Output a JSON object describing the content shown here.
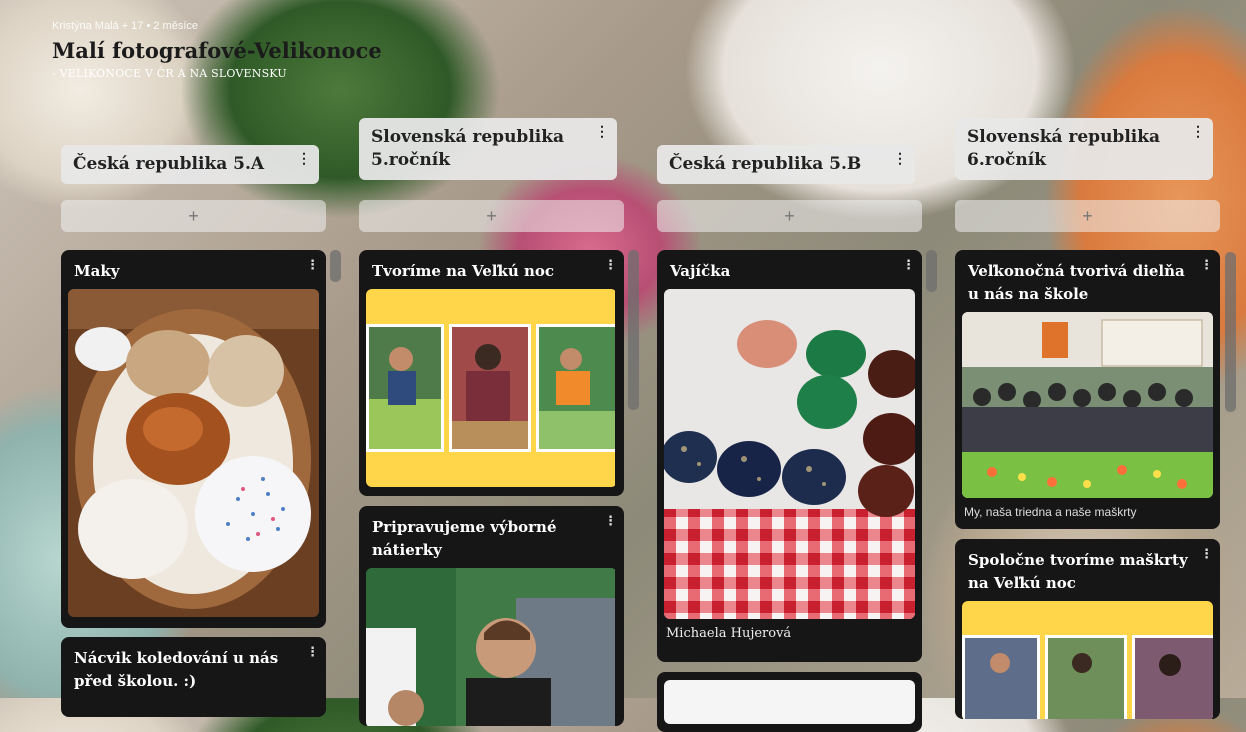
{
  "header": {
    "meta": "Kristýna Malá + 17 • 2 měsíce",
    "title": "Malí fotografové-Velikonoce",
    "subtitle": "- VELIKONOCE V ČR A NA SLOVENSKU"
  },
  "columns": [
    {
      "title": "Česká republika 5.A",
      "add_label": "+",
      "cards": [
        {
          "title": "Maky",
          "image": "photo-easter-breads-basket"
        },
        {
          "title": "Nácvik koledování u nás před školou. :)"
        }
      ]
    },
    {
      "title": "Slovenská republika 5.ročník",
      "add_label": "+",
      "cards": [
        {
          "title": "Tvoríme na Veľkú noc",
          "image": "collage-children-crafting"
        },
        {
          "title": "Pripravujeme výborné nátierky",
          "image": "photo-boy-in-classroom"
        }
      ]
    },
    {
      "title": "Česká republika 5.B",
      "add_label": "+",
      "cards": [
        {
          "title": "Vajíčka",
          "image": "photo-dyed-eggs",
          "caption": "Michaela Hujerová"
        },
        {
          "title": "",
          "image": "photo-white"
        }
      ]
    },
    {
      "title": "Slovenská republika 6.ročník",
      "add_label": "+",
      "cards": [
        {
          "title": "Veľkonočná tvorivá dielňa u nás na škole",
          "image": "photo-class-group",
          "caption": "My, naša triedna a naše maškrty"
        },
        {
          "title": "Spoločne tvoríme maškrty na Veľkú noc",
          "image": "collage-children-food"
        }
      ]
    }
  ],
  "icons": {
    "more": "more-vertical-icon"
  },
  "colors": {
    "card_bg": "#161616",
    "section_bg": "#e8e8e8",
    "collage_yellow": "#ffd54a"
  }
}
